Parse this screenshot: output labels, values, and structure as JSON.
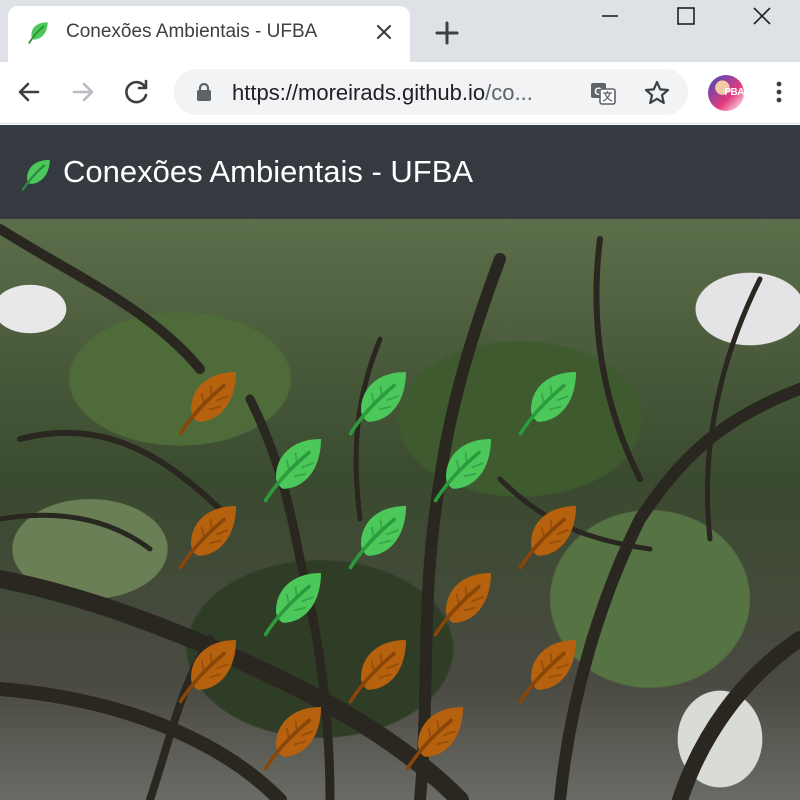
{
  "browser": {
    "tab": {
      "title": "Conexões Ambientais - UFBA"
    },
    "address_bar": {
      "url_host": "https://moreirads.github.io",
      "url_rest": "/co..."
    },
    "avatar_label": "PBA"
  },
  "page": {
    "navbar": {
      "brand": "Conexões Ambientais - UFBA"
    },
    "colors": {
      "navbar": "#343a40",
      "leaf_green": "#4cc75a",
      "leaf_brown": "#b5610d"
    },
    "leaves": [
      {
        "color": "brown"
      },
      {
        "color": "green"
      },
      {
        "color": "green"
      },
      {
        "color": "green"
      },
      {
        "color": "green"
      },
      {
        "color": "brown"
      },
      {
        "color": "green"
      },
      {
        "color": "brown"
      },
      {
        "color": "green"
      },
      {
        "color": "brown"
      },
      {
        "color": "brown"
      },
      {
        "color": "brown"
      },
      {
        "color": "brown"
      },
      {
        "color": "brown"
      },
      {
        "color": "brown"
      }
    ]
  }
}
